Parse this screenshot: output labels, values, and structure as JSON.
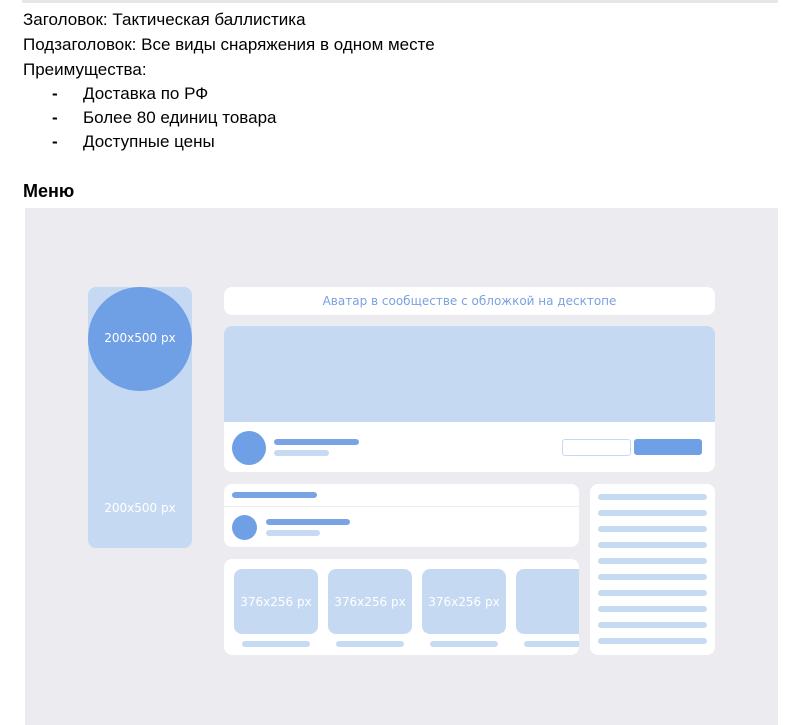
{
  "brief": {
    "title_line": "Заголовок: Тактическая баллистика",
    "subtitle_line": "Подзаголовок: Все виды снаряжения в одном месте",
    "advantages_label": "Преимущества:",
    "bullet_symbol": "-",
    "advantages": [
      "Доставка по РФ",
      "Более 80 единиц товара",
      "Доступные цены"
    ],
    "section_heading": "Меню"
  },
  "mockup": {
    "sidebar_avatar_label": "200x500 px",
    "sidebar_bottom_label": "200x500 px",
    "banner_text": "Аватар в сообществе с обложкой на десктопе",
    "tiles": [
      "376x256 px",
      "376x256 px",
      "376x256 px"
    ],
    "colors": {
      "canvas": "#ebebf0",
      "placeholder": "#c6d9f3",
      "accent": "#6f9fe4",
      "label_blue": "#7aa1e3"
    }
  }
}
